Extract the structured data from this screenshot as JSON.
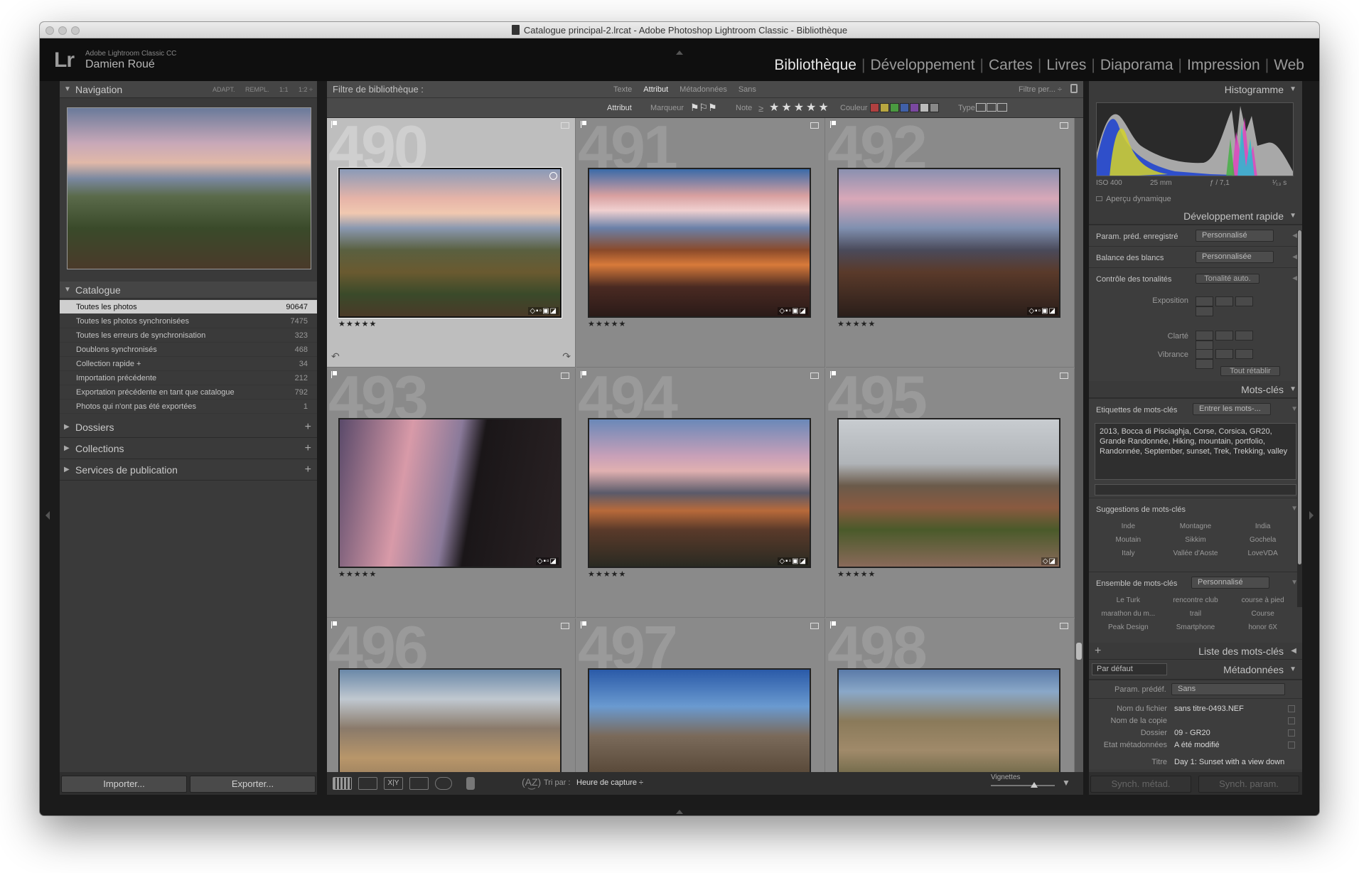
{
  "window": {
    "title": "Catalogue principal-2.lrcat - Adobe Photoshop Lightroom Classic - Bibliothèque"
  },
  "identity": {
    "logo": "Lr",
    "app": "Adobe Lightroom Classic CC",
    "user": "Damien Roué"
  },
  "modules": [
    "Bibliothèque",
    "Développement",
    "Cartes",
    "Livres",
    "Diaporama",
    "Impression",
    "Web"
  ],
  "modules_active": "Bibliothèque",
  "navigator": {
    "title": "Navigation",
    "options": [
      "ADAPT.",
      "REMPL.",
      "1:1",
      "1:2 ÷"
    ]
  },
  "catalogue": {
    "title": "Catalogue",
    "items": [
      {
        "label": "Toutes les photos",
        "count": "90647"
      },
      {
        "label": "Toutes les photos synchronisées",
        "count": "7475"
      },
      {
        "label": "Toutes les erreurs de synchronisation",
        "count": "323"
      },
      {
        "label": "Doublons synchronisés",
        "count": "468"
      },
      {
        "label": "Collection rapide +",
        "count": "34"
      },
      {
        "label": "Importation précédente",
        "count": "212"
      },
      {
        "label": "Exportation précédente en tant que catalogue",
        "count": "792"
      },
      {
        "label": "Photos qui n'ont pas été exportées",
        "count": "1"
      }
    ]
  },
  "left_panels": [
    "Dossiers",
    "Collections",
    "Services de publication"
  ],
  "left_buttons": {
    "import": "Importer...",
    "export": "Exporter..."
  },
  "filter": {
    "label": "Filtre de bibliothèque :",
    "options": [
      "Texte",
      "Attribut",
      "Métadonnées",
      "Sans"
    ],
    "active": "Attribut",
    "preset": "Filtre per... ÷"
  },
  "attribute_bar": {
    "label": "Attribut",
    "flag_label": "Marqueur",
    "rating_label": "Note",
    "rating_op": "≥",
    "stars": "★★★★★",
    "color_label": "Couleur",
    "type_label": "Type"
  },
  "colors": {
    "labels": [
      "#b04040",
      "#b8a640",
      "#4a9a40",
      "#4060a8",
      "#7a48a0",
      "#bbbbbb",
      "#888888"
    ]
  },
  "grid": {
    "cells": [
      {
        "number": "490",
        "stars": "★★★★★",
        "badges": "◇▪▫▣◪",
        "selected": true
      },
      {
        "number": "491",
        "stars": "★★★★★",
        "badges": "◇▪▫▣◪",
        "selected": false
      },
      {
        "number": "492",
        "stars": "★★★★★",
        "badges": "◇▪▫▣◪",
        "selected": false
      },
      {
        "number": "493",
        "stars": "★★★★★",
        "badges": "◇▪▫◪",
        "selected": false
      },
      {
        "number": "494",
        "stars": "★★★★★",
        "badges": "◇▪▫▣◪",
        "selected": false
      },
      {
        "number": "495",
        "stars": "★★★★★",
        "badges": "◇◪",
        "selected": false
      },
      {
        "number": "496",
        "stars": "",
        "badges": "",
        "selected": false
      },
      {
        "number": "497",
        "stars": "",
        "badges": "",
        "selected": false
      },
      {
        "number": "498",
        "stars": "",
        "badges": "",
        "selected": false
      }
    ]
  },
  "toolbar": {
    "sort_label": "Tri par :",
    "sort_value": "Heure de capture ÷",
    "thumbs_label": "Vignettes"
  },
  "histogram": {
    "title": "Histogramme",
    "iso": "ISO 400",
    "focal": "25 mm",
    "aperture": "ƒ / 7,1",
    "shutter": "¹⁄₁₃ s",
    "smart_preview": "Aperçu dynamique"
  },
  "quick_develop": {
    "title": "Développement rapide",
    "preset_label": "Param. préd. enregistré",
    "preset_value": "Personnalisé",
    "wb_label": "Balance des blancs",
    "wb_value": "Personnalisée",
    "tone_label": "Contrôle des tonalités",
    "tone_auto": "Tonalité auto.",
    "exposure": "Exposition",
    "clarity": "Clarté",
    "vibrance": "Vibrance",
    "reset": "Tout rétablir"
  },
  "keywords": {
    "title": "Mots-clés",
    "tags_label": "Etiquettes de mots-clés",
    "tags_mode": "Entrer les mots-...",
    "tags_text": "2013, Bocca di Pisciaghja, Corse, Corsica, GR20, Grande Randonnée, Hiking, mountain, portfolio, Randonnée, September, sunset, Trek, Trekking, valley",
    "suggestions_label": "Suggestions de mots-clés",
    "suggestions": [
      "Inde",
      "Montagne",
      "India",
      "Moutain",
      "Sikkim",
      "Gochela",
      "Italy",
      "Vallée d'Aoste",
      "LoveVDA"
    ],
    "set_label": "Ensemble de mots-clés",
    "set_value": "Personnalisé",
    "set_items": [
      "Le Turk",
      "rencontre club",
      "course à pied",
      "marathon du m...",
      "trail",
      "Course",
      "Peak Design",
      "Smartphone",
      "honor 6X"
    ]
  },
  "keyword_list": {
    "title": "Liste des mots-clés"
  },
  "metadata": {
    "title": "Métadonnées",
    "view": "Par défaut",
    "preset_label": "Param. prédéf.",
    "preset_value": "Sans",
    "filename_label": "Nom du fichier",
    "filename": "sans titre-0493.NEF",
    "copy_label": "Nom de la copie",
    "folder_label": "Dossier",
    "folder": "09 - GR20",
    "status_label": "Etat métadonnées",
    "status": "A été modifié",
    "title_label": "Titre",
    "title_value": "Day 1: Sunset with a view down"
  },
  "right_buttons": {
    "sync_meta": "Synch. métad.",
    "sync_settings": "Synch. param."
  }
}
